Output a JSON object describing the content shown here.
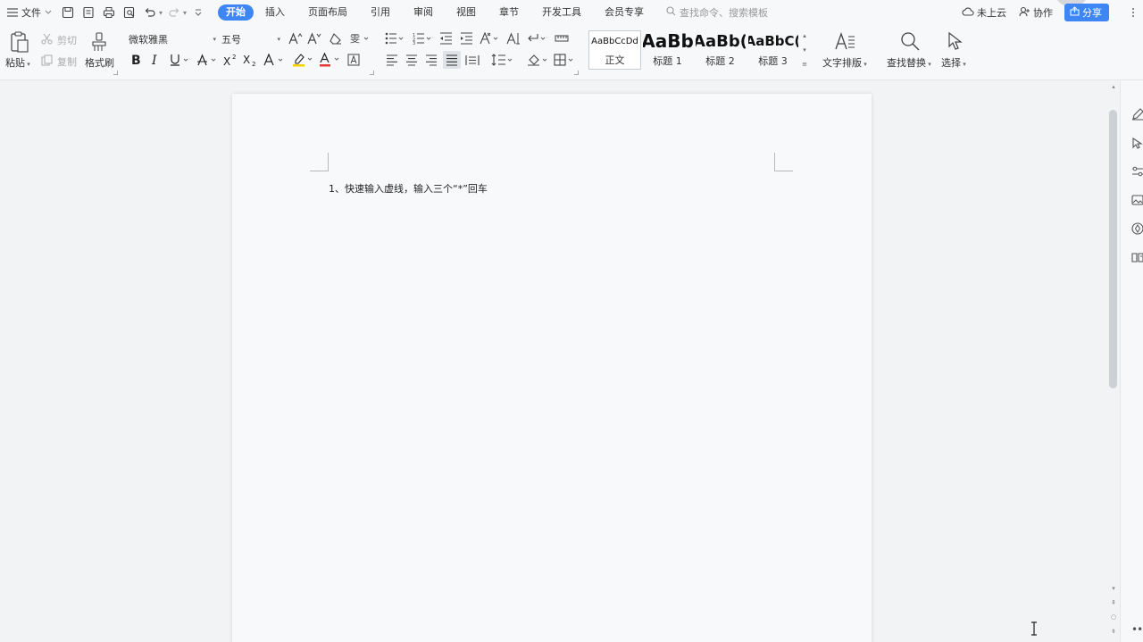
{
  "menubar": {
    "file_label": "文件",
    "quick_access": [
      "save-icon",
      "export-pdf-icon",
      "print-icon",
      "print-preview-icon",
      "undo-icon",
      "redo-icon",
      "customize-caret-icon"
    ],
    "tabs": [
      {
        "label": "开始",
        "active": true
      },
      {
        "label": "插入",
        "active": false
      },
      {
        "label": "页面布局",
        "active": false
      },
      {
        "label": "引用",
        "active": false
      },
      {
        "label": "审阅",
        "active": false
      },
      {
        "label": "视图",
        "active": false
      },
      {
        "label": "章节",
        "active": false
      },
      {
        "label": "开发工具",
        "active": false
      },
      {
        "label": "会员专享",
        "active": false
      }
    ],
    "search_placeholder": "查找命令、搜索模板",
    "cloud_label": "未上云",
    "collab_label": "协作",
    "share_label": "分享"
  },
  "ribbon": {
    "paste_label": "粘贴",
    "cut_label": "剪切",
    "copy_label": "复制",
    "format_painter_label": "格式刷",
    "font_name": "微软雅黑",
    "font_size": "五号",
    "styles": [
      {
        "preview": "AaBbCcDd",
        "name": "正文",
        "selected": true
      },
      {
        "preview": "AaBb",
        "name": "标题 1",
        "selected": false
      },
      {
        "preview": "AaBb(",
        "name": "标题 2",
        "selected": false
      },
      {
        "preview": "AaBbC(",
        "name": "标题 3",
        "selected": false
      }
    ],
    "text_layout_label": "文字排版",
    "find_replace_label": "查找替换",
    "select_label": "选择"
  },
  "document": {
    "lines": [
      "1、快速输入虚线，输入三个“*”回车"
    ]
  },
  "colors": {
    "accent": "#3f86f5",
    "font_color_bar": "#e53935",
    "highlight_bar": "#f5d000"
  }
}
